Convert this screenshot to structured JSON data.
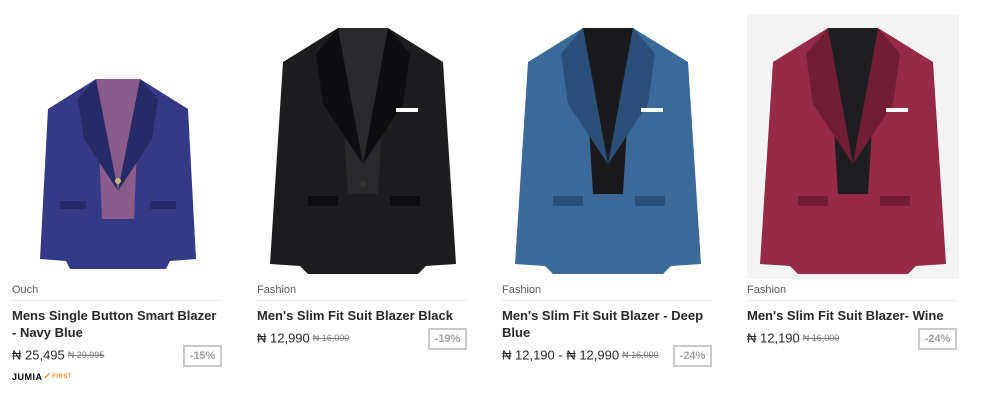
{
  "products": [
    {
      "brand": "Ouch",
      "name": "Mens Single Button Smart Blazer - Navy Blue",
      "price": "₦ 25,495",
      "old_price": "₦ 29,995",
      "discount": "-15%",
      "badge_main": "JUMIA",
      "badge_sub": "FIRST",
      "image_icon": "blazer-icon",
      "colors": {
        "body": "#343a86",
        "dark": "#262a66",
        "lining": "#8a5c8a",
        "shirt": "#8a5c8a"
      }
    },
    {
      "brand": "Fashion",
      "name": "Men's Slim Fit Suit Blazer Black",
      "price": "₦ 12,990",
      "old_price": "₦ 16,000",
      "discount": "-19%",
      "image_icon": "blazer-icon",
      "colors": {
        "body": "#1d1d1f",
        "dark": "#0e0e10",
        "lining": "#2a2a2c",
        "shirt": "#111113"
      }
    },
    {
      "brand": "Fashion",
      "name": "Men's Slim Fit Suit Blazer - Deep Blue",
      "price": "₦ 12,190 - ₦ 12,990",
      "old_price": "₦ 16,000",
      "discount": "-24%",
      "image_icon": "blazer-icon",
      "colors": {
        "body": "#3b6a98",
        "dark": "#2a4f78",
        "lining": "#1a1a1c",
        "shirt": "#1a1a1c"
      }
    },
    {
      "brand": "Fashion",
      "name": "Men's Slim Fit Suit Blazer- Wine",
      "price": "₦ 12,190",
      "old_price": "₦ 16,000",
      "discount": "-24%",
      "image_icon": "blazer-icon",
      "colors": {
        "body": "#962a48",
        "dark": "#721d36",
        "lining": "#1e1e20",
        "shirt": "#1e1e20"
      }
    }
  ]
}
